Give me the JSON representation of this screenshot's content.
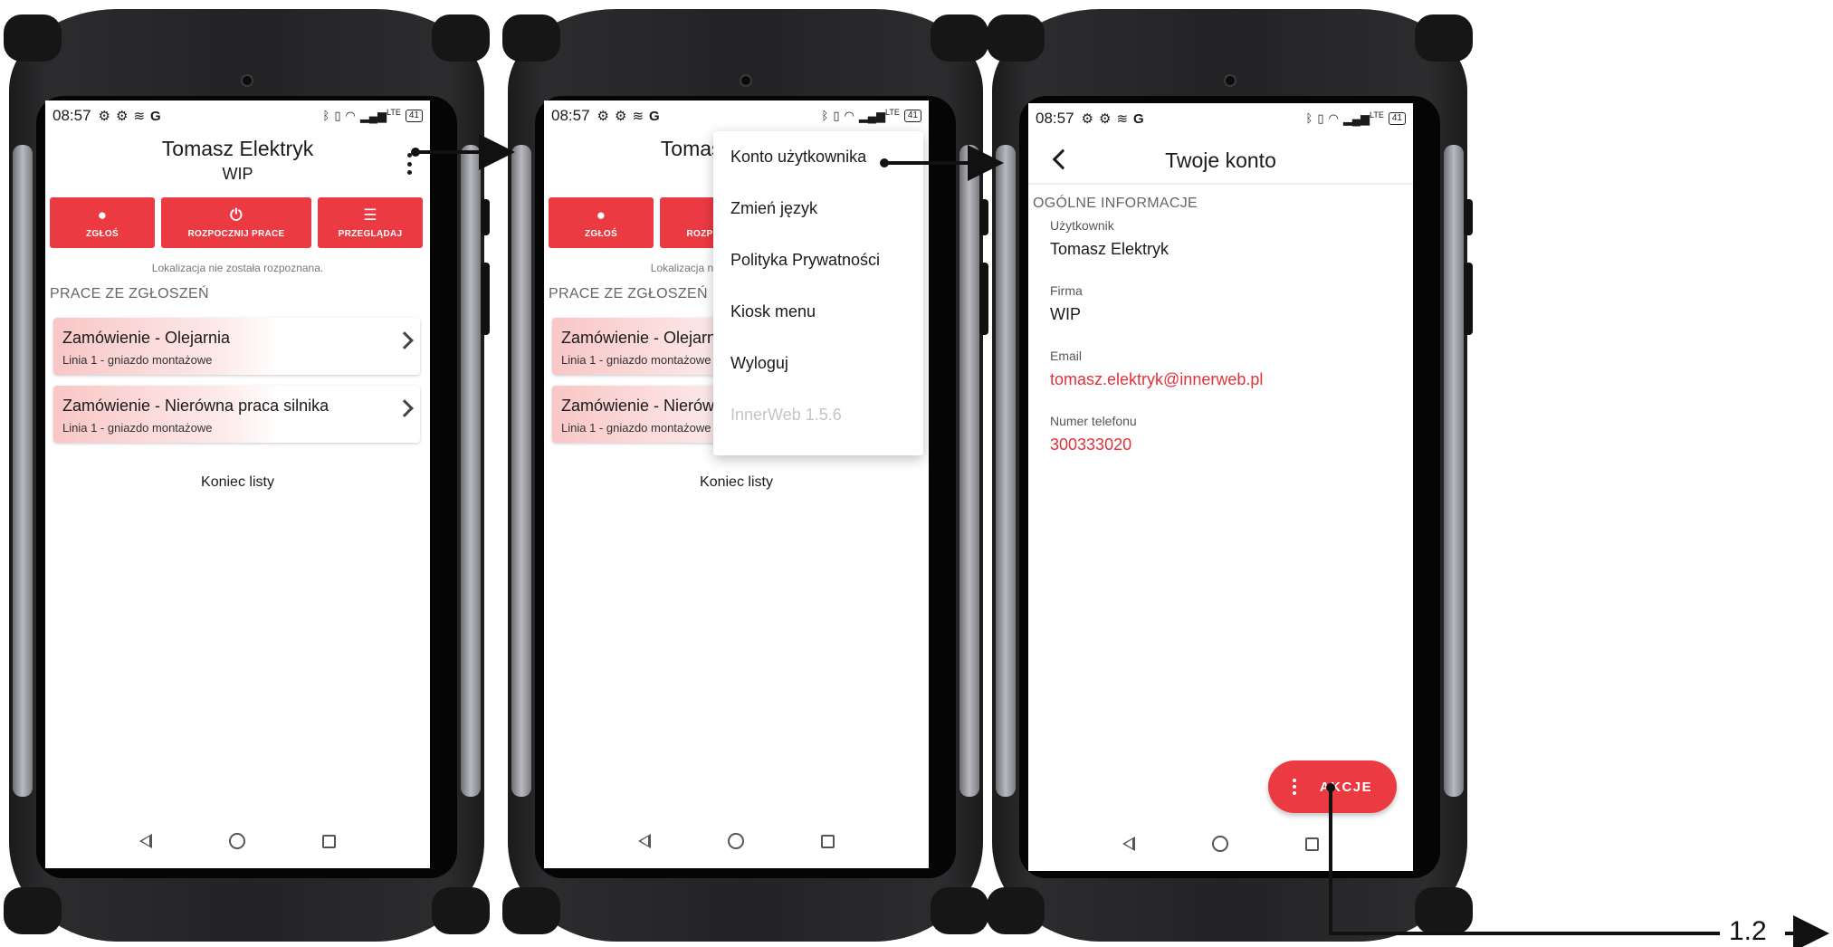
{
  "status_bar": {
    "time": "08:57",
    "lte": "LTE",
    "battery": "41"
  },
  "home": {
    "title": "Tomasz Elektryk",
    "subtitle": "WIP",
    "actions": [
      {
        "label": "ZGŁOŚ",
        "icon": "alert-circle-icon"
      },
      {
        "label": "ROZPOCZNIJ PRACE",
        "icon": "power-icon"
      },
      {
        "label": "PRZEGLĄDAJ",
        "icon": "list-search-icon"
      }
    ],
    "location_note": "Lokalizacja nie została rozpoznana.",
    "section_title": "PRACE ZE ZGŁOSZEŃ",
    "cards": [
      {
        "title": "Zamówienie - Olejarnia",
        "subtitle": "Linia 1 - gniazdo montażowe"
      },
      {
        "title": "Zamówienie - Nierówna praca silnika",
        "subtitle": "Linia 1 - gniazdo montażowe"
      }
    ],
    "list_end": "Koniec listy"
  },
  "menu": {
    "items": [
      "Konto użytkownika",
      "Zmień język",
      "Polityka Prywatności",
      "Kiosk menu",
      "Wyloguj"
    ],
    "version": "InnerWeb 1.5.6"
  },
  "account": {
    "title": "Twoje konto",
    "section": "OGÓLNE INFORMACJE",
    "fields": [
      {
        "label": "Użytkownik",
        "value": "Tomasz Elektryk"
      },
      {
        "label": "Firma",
        "value": "WIP"
      },
      {
        "label": "Email",
        "value": "tomasz.elektryk@innerweb.pl"
      },
      {
        "label": "Numer telefonu",
        "value": "300333020"
      }
    ],
    "fab_label": "AKCJE"
  },
  "annotation": {
    "next_step": "1.2"
  },
  "colors": {
    "accent": "#ec3a43",
    "link": "#e3303a",
    "card_tint": "#f9c6c6"
  }
}
